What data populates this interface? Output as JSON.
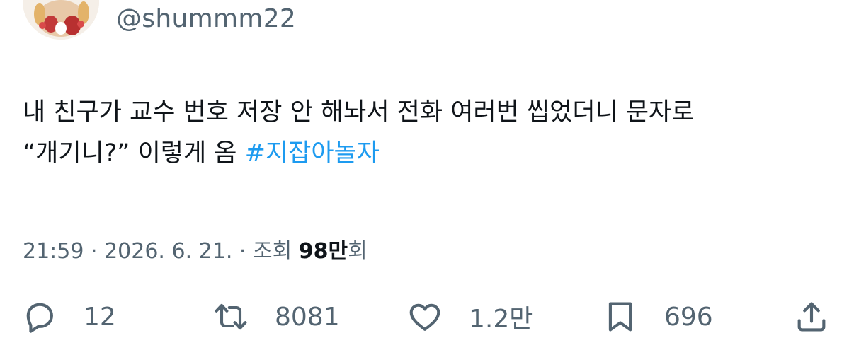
{
  "author": {
    "handle": "@shummm22"
  },
  "tweet": {
    "line1": "내 친구가 교수 번호 저장 안 해놔서 전화 여러번 씹었더니 문자로",
    "line2_text": "“개기니?” 이렇게 옴 ",
    "hashtag": "#지잡아놀자"
  },
  "meta": {
    "time": "21:59",
    "sep1": " · ",
    "date": "2026. 6. 21.",
    "sep2": " · ",
    "views_label": "조회 ",
    "views_count": "98만",
    "views_suffix": "회"
  },
  "actions": {
    "reply_count": "12",
    "retweet_count": "8081",
    "like_count": "1.2만",
    "bookmark_count": "696"
  },
  "icons": {
    "reply": "reply-icon",
    "retweet": "retweet-icon",
    "like": "heart-icon",
    "bookmark": "bookmark-icon",
    "share": "share-icon"
  },
  "colors": {
    "text": "#0f1419",
    "secondary": "#536471",
    "link": "#1d9bf0"
  }
}
